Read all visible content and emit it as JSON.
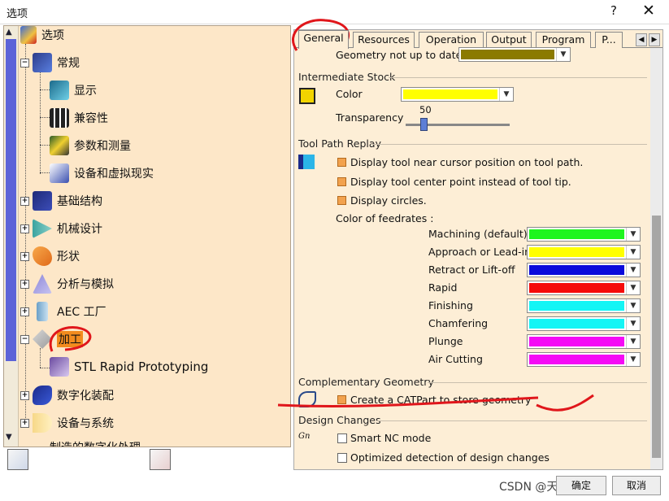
{
  "window": {
    "title": "选项",
    "help": "?",
    "close": "✕"
  },
  "tree": {
    "nodes": [
      {
        "label": "选项"
      },
      {
        "label": "常规"
      },
      {
        "label": "显示"
      },
      {
        "label": "兼容性"
      },
      {
        "label": "参数和测量"
      },
      {
        "label": "设备和虚拟现实"
      },
      {
        "label": "基础结构"
      },
      {
        "label": "机械设计"
      },
      {
        "label": "形状"
      },
      {
        "label": "分析与模拟"
      },
      {
        "label": "AEC 工厂"
      },
      {
        "label": "加工"
      },
      {
        "label": "STL Rapid Prototyping"
      },
      {
        "label": "数字化装配"
      },
      {
        "label": "设备与系统"
      },
      {
        "label": "制造的数字化处理"
      }
    ]
  },
  "tabs": [
    "General",
    "Resources",
    "Operation",
    "Output",
    "Program",
    "P..."
  ],
  "general": {
    "geometry_not_up_to_date": "Geometry not up to date",
    "intermediate_stock": {
      "title": "Intermediate Stock",
      "color_label": "Color",
      "transparency_label": "Transparency",
      "transparency_value": "50"
    },
    "tool_path_replay": {
      "title": "Tool Path Replay",
      "options": [
        "Display tool near cursor position on tool path.",
        "Display tool center point instead of tool tip.",
        "Display circles."
      ],
      "feedrate_title": "Color of feedrates :",
      "feedrates": [
        {
          "label": "Machining (default)",
          "color": "#1ef51e"
        },
        {
          "label": "Approach or Lead-in",
          "color": "#ffff00"
        },
        {
          "label": "Retract or Lift-off",
          "color": "#0a0adb"
        },
        {
          "label": "Rapid",
          "color": "#f50a0a"
        },
        {
          "label": "Finishing",
          "color": "#14f5f5"
        },
        {
          "label": "Chamfering",
          "color": "#14f5f5"
        },
        {
          "label": "Plunge",
          "color": "#f50af5"
        },
        {
          "label": "Air Cutting",
          "color": "#f50af5"
        }
      ]
    },
    "complementary_geometry": {
      "title": "Complementary Geometry",
      "option": "Create a CATPart to store geometry"
    },
    "design_changes": {
      "title": "Design Changes",
      "options": [
        "Smart NC mode",
        "Optimized detection of design changes"
      ]
    }
  },
  "footer": {
    "watermark": "CSDN @天",
    "ok": "确定",
    "cancel": "取消"
  },
  "colors": {
    "geometry_swatch": "#8b7a00",
    "stock_swatch": "#ffff00",
    "selection": "#f28b1e",
    "annotation": "#e0161b"
  }
}
